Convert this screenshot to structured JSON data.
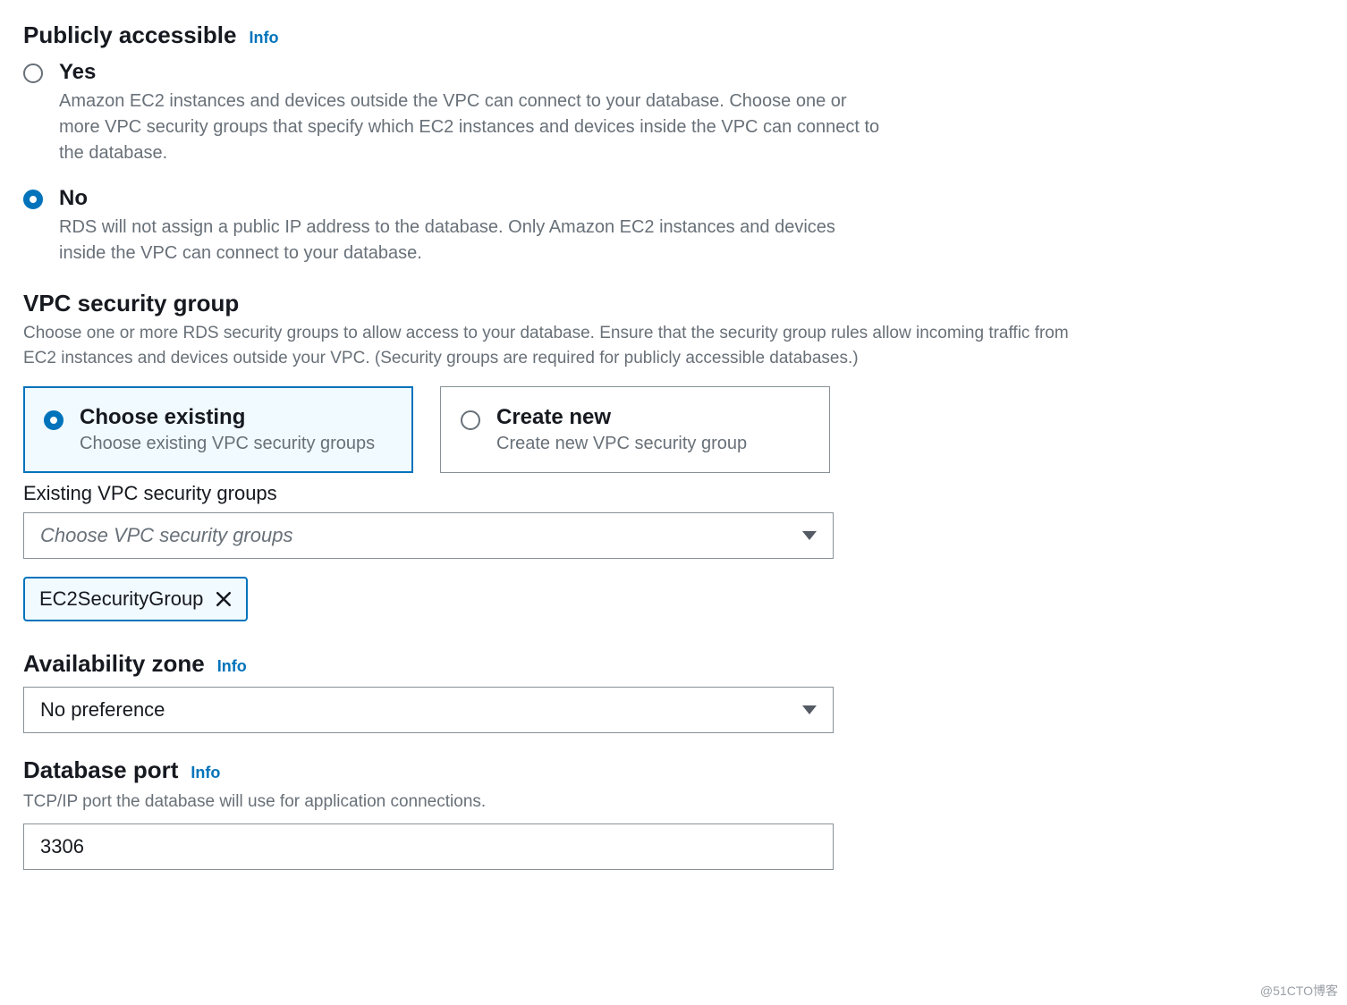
{
  "publicly_accessible": {
    "title": "Publicly accessible",
    "info": "Info",
    "options": {
      "yes": {
        "label": "Yes",
        "desc": "Amazon EC2 instances and devices outside the VPC can connect to your database. Choose one or more VPC security groups that specify which EC2 instances and devices inside the VPC can connect to the database."
      },
      "no": {
        "label": "No",
        "desc": "RDS will not assign a public IP address to the database. Only Amazon EC2 instances and devices inside the VPC can connect to your database."
      }
    },
    "selected": "no"
  },
  "vpc_sg": {
    "title": "VPC security group",
    "desc": "Choose one or more RDS security groups to allow access to your database. Ensure that the security group rules allow incoming traffic from EC2 instances and devices outside your VPC. (Security groups are required for publicly accessible databases.)",
    "tiles": {
      "existing": {
        "title": "Choose existing",
        "desc": "Choose existing VPC security groups"
      },
      "create": {
        "title": "Create new",
        "desc": "Create new VPC security group"
      }
    },
    "selected_tile": "existing",
    "existing_label": "Existing VPC security groups",
    "select_placeholder": "Choose VPC security groups",
    "tokens": [
      "EC2SecurityGroup"
    ]
  },
  "az": {
    "title": "Availability zone",
    "info": "Info",
    "value": "No preference"
  },
  "port": {
    "title": "Database port",
    "info": "Info",
    "desc": "TCP/IP port the database will use for application connections.",
    "value": "3306"
  },
  "watermark": "@51CTO博客"
}
